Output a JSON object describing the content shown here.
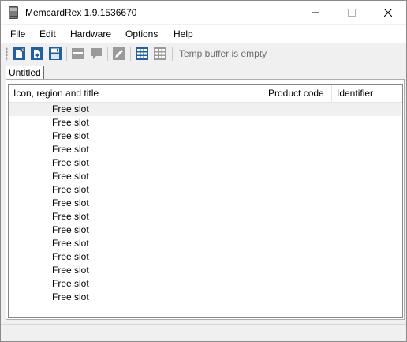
{
  "window": {
    "title": "MemcardRex 1.9.1536670"
  },
  "menu": [
    "File",
    "Edit",
    "Hardware",
    "Options",
    "Help"
  ],
  "toolbar": {
    "buttons": [
      "new-card-icon",
      "open-card-icon",
      "save-card-icon",
      "edit-header-icon",
      "edit-comment-icon",
      "edit-icon",
      "color-grid-icon",
      "gray-grid-icon"
    ],
    "temp_buffer_status": "Temp buffer is empty"
  },
  "tab": {
    "label": "Untitled"
  },
  "table": {
    "columns": [
      "Icon, region and title",
      "Product code",
      "Identifier"
    ],
    "rows": [
      "Free slot",
      "Free slot",
      "Free slot",
      "Free slot",
      "Free slot",
      "Free slot",
      "Free slot",
      "Free slot",
      "Free slot",
      "Free slot",
      "Free slot",
      "Free slot",
      "Free slot",
      "Free slot",
      "Free slot"
    ]
  },
  "colors": {
    "accent_blue": "#1f5fa8",
    "selected_row": "#f0f0f0",
    "disabled_gray": "#9a9a9a"
  }
}
